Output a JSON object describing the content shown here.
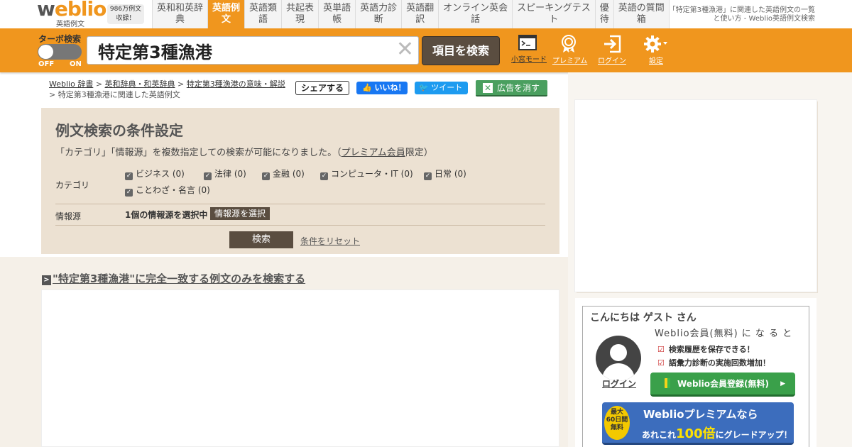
{
  "header": {
    "logo_text": "weblio",
    "logo_sub": "英語例文",
    "badge": "986万例文\n収録！",
    "tabs": [
      {
        "label": "英和和英辞\n典",
        "active": false
      },
      {
        "label": "英語例\n文",
        "active": true
      },
      {
        "label": "英語類\n語",
        "active": false
      },
      {
        "label": "共起表\n現",
        "active": false
      },
      {
        "label": "英単語\n帳",
        "active": false
      },
      {
        "label": "英語力診\n断",
        "active": false
      },
      {
        "label": "英語翻\n訳",
        "active": false
      },
      {
        "label": "オンライン英会\n話",
        "active": false
      },
      {
        "label": "スピーキングテス\nト",
        "active": false
      },
      {
        "label": "優\n待",
        "active": false
      },
      {
        "label": "英語の質問\n箱",
        "active": false
      }
    ],
    "description": "「特定第3種漁港」に関連した英語例文の一覧と使い方 - Weblio英語例文検索"
  },
  "search": {
    "turbo_label": "ターボ検索",
    "toggle_off": "OFF",
    "toggle_on": "ON",
    "query": "特定第3種漁港",
    "clear_symbol": "✕",
    "button_label": "項目を検索",
    "tools": {
      "compact": "小窓モード",
      "premium": "プレミアム",
      "login": "ログイン",
      "settings": "設定"
    }
  },
  "breadcrumb": {
    "items": [
      "Weblio 辞書",
      "英和辞典・和英辞典",
      "特定第3種漁港の意味・解説"
    ],
    "separator": " > ",
    "current": "特定第3種漁港に関連した英語例文"
  },
  "social": {
    "share": "シェアする",
    "like": "いいね！",
    "tweet": "ツイート",
    "hide_ads": "広告を消す"
  },
  "conditions": {
    "title": "例文検索の条件設定",
    "desc_prefix": "「カテゴリ」「情報源」を複数指定しての検索が可能になりました。（",
    "desc_link": "プレミアム会員",
    "desc_suffix": "限定）",
    "category_label": "カテゴリ",
    "categories": [
      "ビジネス (0)",
      "法律 (0)",
      "金融 (0)",
      "コンピュータ・IT (0)",
      "日常 (0)",
      "ことわざ・名言 (0)"
    ],
    "source_label": "情報源",
    "source_selected": "1個の情報源を選択中",
    "source_button": "情報源を選択",
    "search_button": "検索",
    "reset_link": "条件をリセット"
  },
  "exact_match": {
    "arrow": ">",
    "text": "\"特定第3種漁港\"に完全一致する例文のみを検索する"
  },
  "member_box": {
    "greeting": "こんにちは ゲスト さん",
    "login": "ログイン",
    "join_title": "Weblio会員(無料) に な る と",
    "benefits": [
      "検索履歴を保存できる！",
      "語彙力診断の実施回数増加！"
    ],
    "register_button": "Weblio会員登録(無料)",
    "premium_badge": "最大\n60日間\n無料",
    "premium_line1": "Weblioプレミアムなら",
    "premium_line2_a": "あれこれ",
    "premium_line2_b": "100倍",
    "premium_line2_c": "にグレードアップ！"
  },
  "colors": {
    "brand_orange": "#f0961e",
    "dark_button": "#5a4d40",
    "panel_beige": "#ece1d2"
  }
}
